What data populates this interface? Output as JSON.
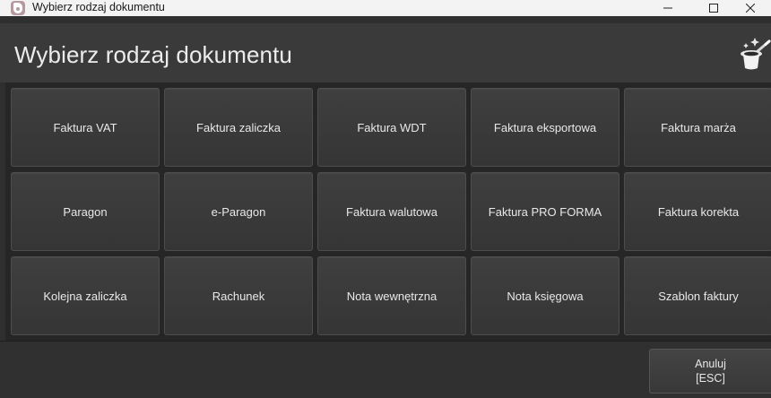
{
  "window": {
    "title": "Wybierz rodzaj dokumentu",
    "controls": {
      "minimize_icon": "minimize-icon",
      "maximize_icon": "maximize-icon",
      "close_icon": "close-icon"
    }
  },
  "dialog": {
    "title": "Wybierz rodzaj dokumentu",
    "corner_icon": "magic-hat-icon"
  },
  "documents": [
    "Faktura VAT",
    "Faktura zaliczka",
    "Faktura WDT",
    "Faktura eksportowa",
    "Faktura marża",
    "Paragon",
    "e-Paragon",
    "Faktura walutowa",
    "Faktura PRO FORMA",
    "Faktura korekta",
    "Kolejna zaliczka",
    "Rachunek",
    "Nota wewnętrzna",
    "Nota księgowa",
    "Szablon faktury"
  ],
  "footer": {
    "cancel_label": "Anuluj",
    "cancel_shortcut": "[ESC]"
  }
}
